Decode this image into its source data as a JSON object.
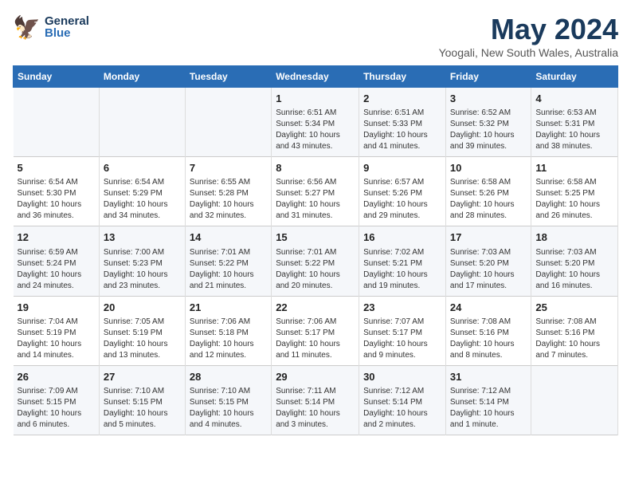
{
  "header": {
    "logo_general": "General",
    "logo_blue": "Blue",
    "month_year": "May 2024",
    "location": "Yoogali, New South Wales, Australia"
  },
  "days_of_week": [
    "Sunday",
    "Monday",
    "Tuesday",
    "Wednesday",
    "Thursday",
    "Friday",
    "Saturday"
  ],
  "weeks": [
    [
      {
        "day": "",
        "sunrise": "",
        "sunset": "",
        "daylight": ""
      },
      {
        "day": "",
        "sunrise": "",
        "sunset": "",
        "daylight": ""
      },
      {
        "day": "",
        "sunrise": "",
        "sunset": "",
        "daylight": ""
      },
      {
        "day": "1",
        "sunrise": "Sunrise: 6:51 AM",
        "sunset": "Sunset: 5:34 PM",
        "daylight": "Daylight: 10 hours and 43 minutes."
      },
      {
        "day": "2",
        "sunrise": "Sunrise: 6:51 AM",
        "sunset": "Sunset: 5:33 PM",
        "daylight": "Daylight: 10 hours and 41 minutes."
      },
      {
        "day": "3",
        "sunrise": "Sunrise: 6:52 AM",
        "sunset": "Sunset: 5:32 PM",
        "daylight": "Daylight: 10 hours and 39 minutes."
      },
      {
        "day": "4",
        "sunrise": "Sunrise: 6:53 AM",
        "sunset": "Sunset: 5:31 PM",
        "daylight": "Daylight: 10 hours and 38 minutes."
      }
    ],
    [
      {
        "day": "5",
        "sunrise": "Sunrise: 6:54 AM",
        "sunset": "Sunset: 5:30 PM",
        "daylight": "Daylight: 10 hours and 36 minutes."
      },
      {
        "day": "6",
        "sunrise": "Sunrise: 6:54 AM",
        "sunset": "Sunset: 5:29 PM",
        "daylight": "Daylight: 10 hours and 34 minutes."
      },
      {
        "day": "7",
        "sunrise": "Sunrise: 6:55 AM",
        "sunset": "Sunset: 5:28 PM",
        "daylight": "Daylight: 10 hours and 32 minutes."
      },
      {
        "day": "8",
        "sunrise": "Sunrise: 6:56 AM",
        "sunset": "Sunset: 5:27 PM",
        "daylight": "Daylight: 10 hours and 31 minutes."
      },
      {
        "day": "9",
        "sunrise": "Sunrise: 6:57 AM",
        "sunset": "Sunset: 5:26 PM",
        "daylight": "Daylight: 10 hours and 29 minutes."
      },
      {
        "day": "10",
        "sunrise": "Sunrise: 6:58 AM",
        "sunset": "Sunset: 5:26 PM",
        "daylight": "Daylight: 10 hours and 28 minutes."
      },
      {
        "day": "11",
        "sunrise": "Sunrise: 6:58 AM",
        "sunset": "Sunset: 5:25 PM",
        "daylight": "Daylight: 10 hours and 26 minutes."
      }
    ],
    [
      {
        "day": "12",
        "sunrise": "Sunrise: 6:59 AM",
        "sunset": "Sunset: 5:24 PM",
        "daylight": "Daylight: 10 hours and 24 minutes."
      },
      {
        "day": "13",
        "sunrise": "Sunrise: 7:00 AM",
        "sunset": "Sunset: 5:23 PM",
        "daylight": "Daylight: 10 hours and 23 minutes."
      },
      {
        "day": "14",
        "sunrise": "Sunrise: 7:01 AM",
        "sunset": "Sunset: 5:22 PM",
        "daylight": "Daylight: 10 hours and 21 minutes."
      },
      {
        "day": "15",
        "sunrise": "Sunrise: 7:01 AM",
        "sunset": "Sunset: 5:22 PM",
        "daylight": "Daylight: 10 hours and 20 minutes."
      },
      {
        "day": "16",
        "sunrise": "Sunrise: 7:02 AM",
        "sunset": "Sunset: 5:21 PM",
        "daylight": "Daylight: 10 hours and 19 minutes."
      },
      {
        "day": "17",
        "sunrise": "Sunrise: 7:03 AM",
        "sunset": "Sunset: 5:20 PM",
        "daylight": "Daylight: 10 hours and 17 minutes."
      },
      {
        "day": "18",
        "sunrise": "Sunrise: 7:03 AM",
        "sunset": "Sunset: 5:20 PM",
        "daylight": "Daylight: 10 hours and 16 minutes."
      }
    ],
    [
      {
        "day": "19",
        "sunrise": "Sunrise: 7:04 AM",
        "sunset": "Sunset: 5:19 PM",
        "daylight": "Daylight: 10 hours and 14 minutes."
      },
      {
        "day": "20",
        "sunrise": "Sunrise: 7:05 AM",
        "sunset": "Sunset: 5:19 PM",
        "daylight": "Daylight: 10 hours and 13 minutes."
      },
      {
        "day": "21",
        "sunrise": "Sunrise: 7:06 AM",
        "sunset": "Sunset: 5:18 PM",
        "daylight": "Daylight: 10 hours and 12 minutes."
      },
      {
        "day": "22",
        "sunrise": "Sunrise: 7:06 AM",
        "sunset": "Sunset: 5:17 PM",
        "daylight": "Daylight: 10 hours and 11 minutes."
      },
      {
        "day": "23",
        "sunrise": "Sunrise: 7:07 AM",
        "sunset": "Sunset: 5:17 PM",
        "daylight": "Daylight: 10 hours and 9 minutes."
      },
      {
        "day": "24",
        "sunrise": "Sunrise: 7:08 AM",
        "sunset": "Sunset: 5:16 PM",
        "daylight": "Daylight: 10 hours and 8 minutes."
      },
      {
        "day": "25",
        "sunrise": "Sunrise: 7:08 AM",
        "sunset": "Sunset: 5:16 PM",
        "daylight": "Daylight: 10 hours and 7 minutes."
      }
    ],
    [
      {
        "day": "26",
        "sunrise": "Sunrise: 7:09 AM",
        "sunset": "Sunset: 5:15 PM",
        "daylight": "Daylight: 10 hours and 6 minutes."
      },
      {
        "day": "27",
        "sunrise": "Sunrise: 7:10 AM",
        "sunset": "Sunset: 5:15 PM",
        "daylight": "Daylight: 10 hours and 5 minutes."
      },
      {
        "day": "28",
        "sunrise": "Sunrise: 7:10 AM",
        "sunset": "Sunset: 5:15 PM",
        "daylight": "Daylight: 10 hours and 4 minutes."
      },
      {
        "day": "29",
        "sunrise": "Sunrise: 7:11 AM",
        "sunset": "Sunset: 5:14 PM",
        "daylight": "Daylight: 10 hours and 3 minutes."
      },
      {
        "day": "30",
        "sunrise": "Sunrise: 7:12 AM",
        "sunset": "Sunset: 5:14 PM",
        "daylight": "Daylight: 10 hours and 2 minutes."
      },
      {
        "day": "31",
        "sunrise": "Sunrise: 7:12 AM",
        "sunset": "Sunset: 5:14 PM",
        "daylight": "Daylight: 10 hours and 1 minute."
      },
      {
        "day": "",
        "sunrise": "",
        "sunset": "",
        "daylight": ""
      }
    ]
  ]
}
